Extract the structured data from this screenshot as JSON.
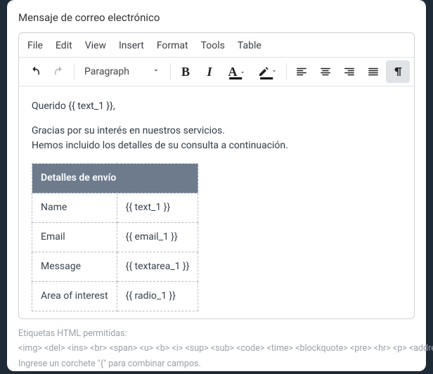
{
  "title": "Mensaje de correo electrónico",
  "menu": {
    "file": "File",
    "edit": "Edit",
    "view": "View",
    "insert": "Insert",
    "format": "Format",
    "tools": "Tools",
    "table": "Table"
  },
  "toolbar": {
    "format_select": "Paragraph",
    "bold": "B",
    "italic": "I",
    "textcolor": "A"
  },
  "body": {
    "greeting": "Querido {{ text_1 }},",
    "line1": "Gracias por su interés en nuestros servicios.",
    "line2": "Hemos incluido los detalles de su consulta a continuación."
  },
  "table": {
    "header": "Detalles de envío",
    "rows": [
      {
        "k": "Name",
        "v": "{{ text_1 }}"
      },
      {
        "k": "Email",
        "v": "{{ email_1 }}"
      },
      {
        "k": "Message",
        "v": "{{ textarea_1 }}"
      },
      {
        "k": "Area of interest",
        "v": "{{ radio_1 }}"
      }
    ]
  },
  "helper": {
    "allowed_label": "Etiquetas HTML permitidas: ",
    "tags": "<img> <del> <ins> <br> <span> <u> <b> <i> <sup> <sub> <code> <time> <blockquote> <pre> <hr> <p> <address> <table> <thead> <tbody> <tr> <th> <td>",
    "hint": "Ingrese un corchete \"{\" para combinar campos."
  }
}
